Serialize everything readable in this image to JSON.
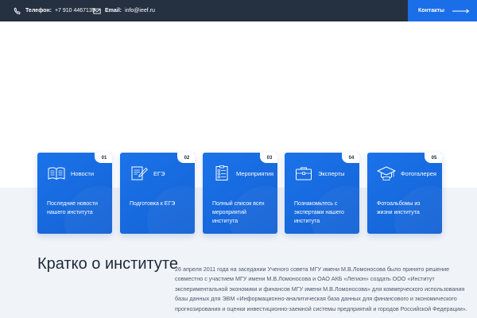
{
  "topbar": {
    "phone_label": "Телефон:",
    "phone_value": "+7 910 4467135",
    "email_label": "Email:",
    "email_value": "info@ieef.ru",
    "contacts_button": "Контакты"
  },
  "cards": [
    {
      "number": "01",
      "title": "Новости",
      "description": "Последние новости нашего института",
      "icon": "book-icon"
    },
    {
      "number": "02",
      "title": "ЕГЭ",
      "description": "Подготовка к ЕГЭ",
      "icon": "exam-edit-icon"
    },
    {
      "number": "03",
      "title": "Мероприятия",
      "description": "Полный список всех мероприятий института",
      "icon": "checklist-icon"
    },
    {
      "number": "04",
      "title": "Эксперты",
      "description": "Познакомьтесь с экспертами нашего института",
      "icon": "briefcase-icon"
    },
    {
      "number": "05",
      "title": "Фотогалерея",
      "description": "Фотоальбомы из жизни института",
      "icon": "graduation-cap-icon"
    }
  ],
  "about": {
    "title": "Кратко о институте",
    "text": "26 апреля 2011 года на заседании  Ученого совета МГУ имени М.В.Ломоносова было принято решение совместно с участием МГУ имени М.В.Ломоносова и ОАО АКБ «Легион» создать ООО «Институт экспериментальной экономики и финансов МГУ имени М.В.Ломоносова» для коммерческого использования базы данных для ЭВМ «Информационно-аналитическая база данных для финансового и экономического прогнозирования и оценки инвестиционно-заемной системы предприятий и городов Российской Федерации»."
  },
  "colors": {
    "topbar": "#253041",
    "accent": "#1a6fe8",
    "lower_bg": "#f0f3f8"
  }
}
